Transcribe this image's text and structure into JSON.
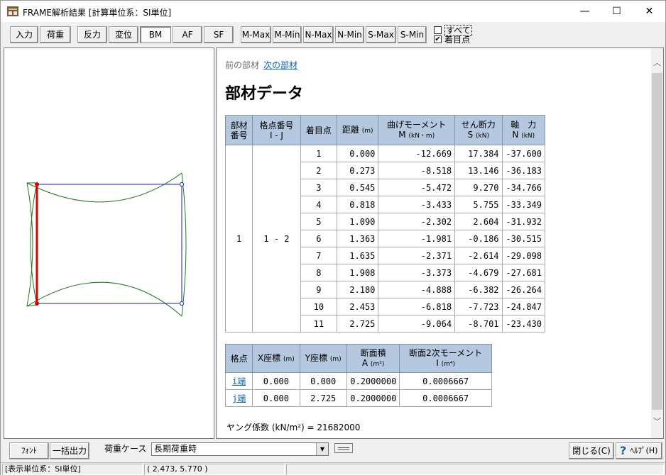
{
  "window": {
    "title": "FRAME解析結果 [計算単位系：SI単位]",
    "minimize_glyph": "—",
    "maximize_glyph": "☐",
    "close_glyph": "✕"
  },
  "toolbar": {
    "input": "入力",
    "load": "荷重",
    "reaction": "反力",
    "displacement": "変位",
    "bm": "BM",
    "af": "AF",
    "sf": "SF",
    "m_max": "M-Max",
    "m_min": "M-Min",
    "n_max": "N-Max",
    "n_min": "N-Min",
    "s_max": "S-Max",
    "s_min": "S-Min",
    "check_all": "すべて",
    "check_focus": "着目点",
    "check_all_checked": false,
    "check_focus_checked": true,
    "active_button": "BM"
  },
  "nav": {
    "prev": "前の部材",
    "next": "次の部材"
  },
  "heading": "部材データ",
  "member_table": {
    "headers": {
      "member_no": [
        "部材",
        "番号"
      ],
      "node_no": [
        "格点番号",
        "I - J"
      ],
      "focus_point": "着目点",
      "distance": "距離",
      "distance_unit": "(m)",
      "moment": "曲げモーメント",
      "moment_sym": "M",
      "moment_unit": "(kN・m)",
      "shear": "せん断力",
      "shear_sym": "S",
      "shear_unit": "(kN)",
      "axial": "軸　力",
      "axial_sym": "N",
      "axial_unit": "(kN)"
    },
    "member_no": "1",
    "node_pair": "1 - 2",
    "rows": [
      {
        "point": "1",
        "distance": "0.000",
        "moment": "-12.669",
        "shear": "17.384",
        "axial": "-37.600"
      },
      {
        "point": "2",
        "distance": "0.273",
        "moment": "-8.518",
        "shear": "13.146",
        "axial": "-36.183"
      },
      {
        "point": "3",
        "distance": "0.545",
        "moment": "-5.472",
        "shear": "9.270",
        "axial": "-34.766"
      },
      {
        "point": "4",
        "distance": "0.818",
        "moment": "-3.433",
        "shear": "5.755",
        "axial": "-33.349"
      },
      {
        "point": "5",
        "distance": "1.090",
        "moment": "-2.302",
        "shear": "2.604",
        "axial": "-31.932"
      },
      {
        "point": "6",
        "distance": "1.363",
        "moment": "-1.981",
        "shear": "-0.186",
        "axial": "-30.515"
      },
      {
        "point": "7",
        "distance": "1.635",
        "moment": "-2.371",
        "shear": "-2.614",
        "axial": "-29.098"
      },
      {
        "point": "8",
        "distance": "1.908",
        "moment": "-3.373",
        "shear": "-4.679",
        "axial": "-27.681"
      },
      {
        "point": "9",
        "distance": "2.180",
        "moment": "-4.888",
        "shear": "-6.382",
        "axial": "-26.264"
      },
      {
        "point": "10",
        "distance": "2.453",
        "moment": "-6.818",
        "shear": "-7.723",
        "axial": "-24.847"
      },
      {
        "point": "11",
        "distance": "2.725",
        "moment": "-9.064",
        "shear": "-8.701",
        "axial": "-23.430"
      }
    ]
  },
  "node_table": {
    "headers": {
      "node": "格点",
      "x": "X座標",
      "x_unit": "(m)",
      "y": "Y座標",
      "y_unit": "(m)",
      "area": "断面積",
      "area_sym": "A",
      "area_unit": "(m²)",
      "inertia": "断面2次モーメント",
      "inertia_sym": "I",
      "inertia_unit": "(m⁴)"
    },
    "rows": [
      {
        "node": "i端",
        "x": "0.000",
        "y": "0.000",
        "area": "0.2000000",
        "inertia": "0.0006667"
      },
      {
        "node": "j端",
        "x": "0.000",
        "y": "2.725",
        "area": "0.2000000",
        "inertia": "0.0006667"
      }
    ]
  },
  "youngs_modulus": "ヤング係数 (kN/m²) = 21682000",
  "bottom": {
    "font_button": "ﾌｫﾝﾄ",
    "batch_output": "一括出力",
    "load_case_label": "荷重ケース",
    "load_case_value": "長期荷重時",
    "close_button": "閉じる(C)",
    "help_button": "ﾍﾙﾌﾟ(H)",
    "help_icon_glyph": "?"
  },
  "status": {
    "unit_system": "[表示単位系：SI単位]",
    "coordinates": "(   2.473,    5.770 )"
  },
  "colors": {
    "frame_blue": "#1a1adc",
    "moment_green": "#1e7a1e",
    "selected_red": "#e00000",
    "header_blue": "#b4c8e0",
    "link_blue": "#0b5fb3"
  }
}
